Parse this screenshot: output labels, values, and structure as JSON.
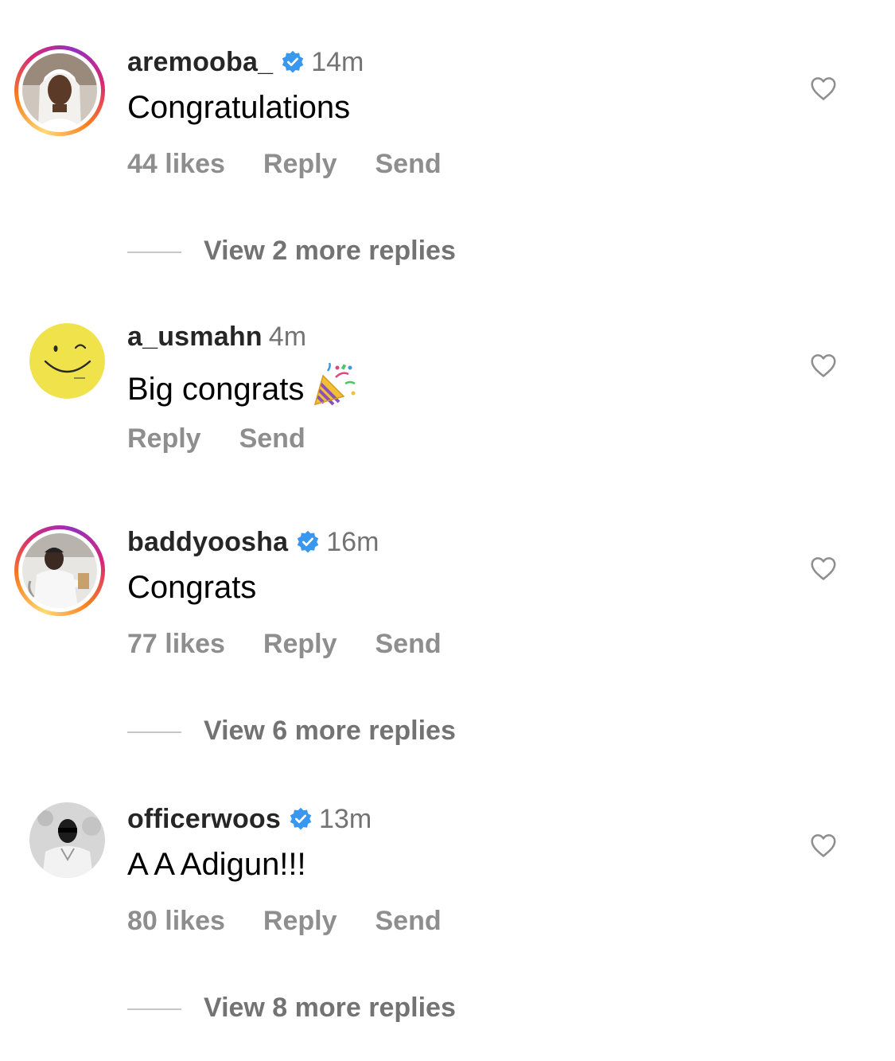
{
  "comments": [
    {
      "username": "aremooba_",
      "verified": true,
      "time": "14m",
      "text": "Congratulations",
      "likes": "44 likes",
      "reply": "Reply",
      "send": "Send",
      "view_replies": "View 2 more replies"
    },
    {
      "username": "a_usmahn",
      "verified": false,
      "time": "4m",
      "text": "Big congrats",
      "emoji": "party-popper",
      "reply": "Reply",
      "send": "Send"
    },
    {
      "username": "baddyoosha",
      "verified": true,
      "time": "16m",
      "text": "Congrats",
      "likes": "77 likes",
      "reply": "Reply",
      "send": "Send",
      "view_replies": "View 6 more replies"
    },
    {
      "username": "officerwoos",
      "verified": true,
      "time": "13m",
      "text": "A A Adigun!!!",
      "likes": "80 likes",
      "reply": "Reply",
      "send": "Send",
      "view_replies": "View 8 more replies"
    }
  ],
  "colors": {
    "verified_blue": "#3897f0",
    "secondary_text": "#8e8e8e",
    "story_ring": "#d62976"
  }
}
